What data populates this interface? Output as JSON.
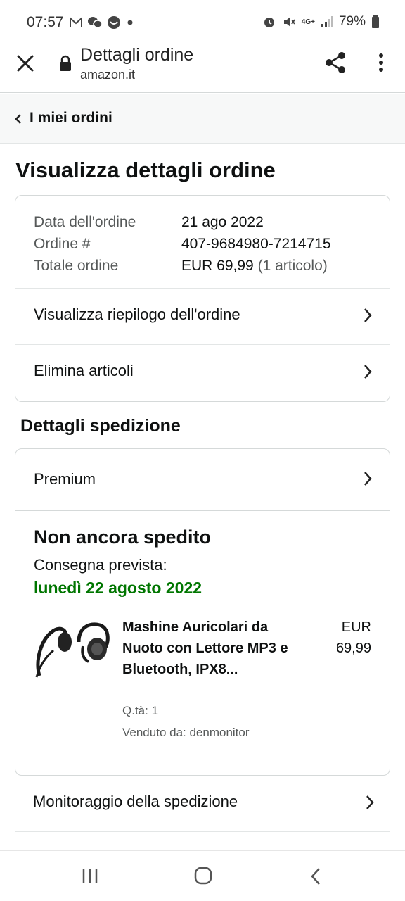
{
  "status_bar": {
    "time": "07:57",
    "battery": "79%",
    "network": "4G+",
    "icons": [
      "gmail-icon",
      "wechat-icon",
      "wechat-alt-icon",
      "dot-icon",
      "alarm-icon",
      "mute-icon",
      "signal-icon",
      "battery-icon"
    ]
  },
  "browser": {
    "title": "Dettagli ordine",
    "domain": "amazon.it"
  },
  "breadcrumb": {
    "label": "I miei ordini"
  },
  "page": {
    "title": "Visualizza dettagli ordine"
  },
  "order": {
    "date_label": "Data dell'ordine",
    "date_value": "21 ago 2022",
    "number_label": "Ordine #",
    "number_value": "407-9684980-7214715",
    "total_label": "Totale ordine",
    "total_value": "EUR 69,99",
    "total_count": "(1 articolo)",
    "summary_link": "Visualizza riepilogo dell'ordine",
    "delete_link": "Elimina articoli"
  },
  "shipping": {
    "section_title": "Dettagli spedizione",
    "service": "Premium",
    "status": "Non ancora spedito",
    "delivery_label": "Consegna prevista:",
    "delivery_date": "lunedì 22 agosto 2022",
    "product": {
      "name": "Mashine Auricolari da Nuoto con Lettore MP3 e Bluetooth, IPX8...",
      "price_currency": "EUR",
      "price_amount": "69,99",
      "quantity": "Q.tà: 1",
      "seller": "Venduto da: denmonitor"
    },
    "tracking_link": "Monitoraggio della spedizione"
  },
  "colors": {
    "delivery_green": "#007600",
    "border": "#d5d9d9",
    "muted_text": "#565959"
  }
}
